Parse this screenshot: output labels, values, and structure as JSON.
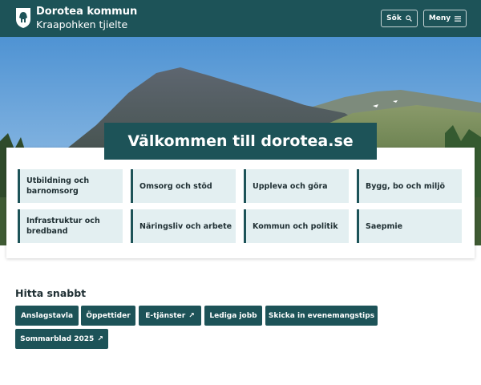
{
  "header": {
    "brand_name": "Dorotea kommun",
    "brand_sub": "Kraapohken tjielte",
    "search_label": "Sök",
    "menu_label": "Meny",
    "logo_icon": "dorotea-coat-of-arms-icon"
  },
  "hero": {
    "welcome_title": "Välkommen till dorotea.se"
  },
  "categories": [
    {
      "label": "Utbildning och barnomsorg"
    },
    {
      "label": "Omsorg och stöd"
    },
    {
      "label": "Uppleva och göra"
    },
    {
      "label": "Bygg, bo och miljö"
    },
    {
      "label": "Infrastruktur och bredband"
    },
    {
      "label": "Näringsliv och arbete"
    },
    {
      "label": "Kommun och politik"
    },
    {
      "label": "Saepmie"
    }
  ],
  "quick": {
    "title": "Hitta snabbt",
    "links": [
      {
        "label": "Anslagstavla"
      },
      {
        "label": "Öppettider"
      },
      {
        "label": "E-tjänster"
      },
      {
        "label": "Lediga jobb"
      },
      {
        "label": "Skicka in evenemangstips"
      },
      {
        "label": "Sommarblad 2025"
      }
    ]
  },
  "colors": {
    "brand": "#1d5358",
    "tile_background": "#e3eff1"
  }
}
